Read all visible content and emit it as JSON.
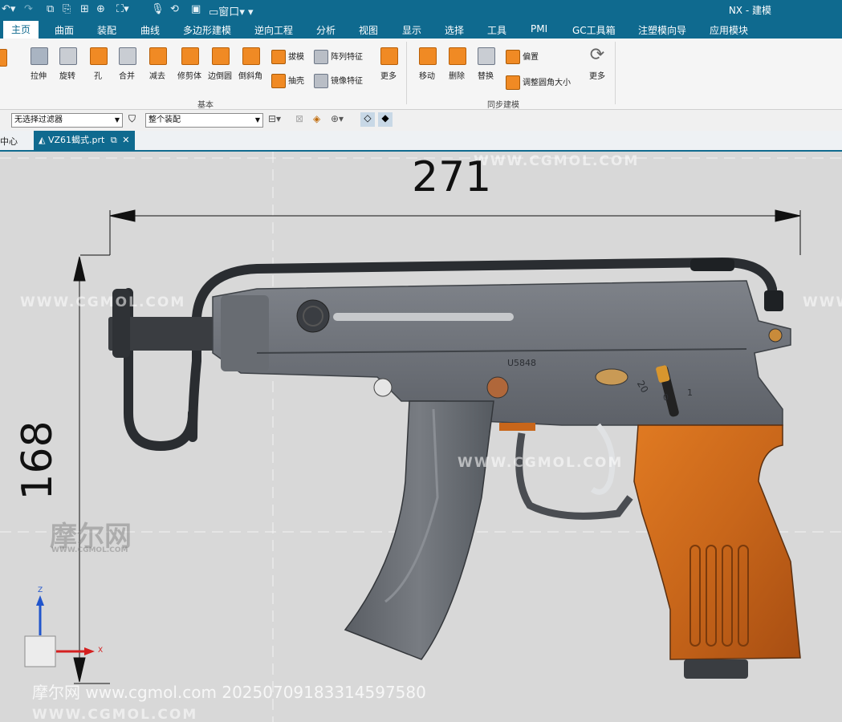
{
  "app": {
    "title": "NX - 建模"
  },
  "quick_access": {
    "window_label": "窗口"
  },
  "menu": {
    "tabs": [
      "主页",
      "曲面",
      "装配",
      "曲线",
      "多边形建模",
      "逆向工程",
      "分析",
      "视图",
      "显示",
      "选择",
      "工具",
      "PMI",
      "GC工具箱",
      "注塑模向导",
      "应用模块"
    ],
    "active": "主页"
  },
  "ribbon": {
    "basic_group": {
      "label": "基本",
      "buttons": [
        "拉伸",
        "旋转",
        "孔",
        "合并",
        "减去",
        "修剪体",
        "边倒圆",
        "倒斜角"
      ],
      "small_buttons": [
        "拔模",
        "阵列特征",
        "抽壳",
        "镜像特征"
      ],
      "more": "更多"
    },
    "sync_group": {
      "label": "同步建模",
      "buttons": [
        "移动",
        "删除",
        "替换"
      ],
      "small_buttons": [
        "偏置",
        "调整圆角大小"
      ],
      "more": "更多"
    }
  },
  "filter_bar": {
    "type_filter": "无选择过滤器",
    "scope_filter": "整个装配"
  },
  "doc_tabs": {
    "left_tab": "中心",
    "active_tab": "VZ61蝎式.prt"
  },
  "model": {
    "dim_width": "271",
    "dim_height": "168",
    "serial": "U5848",
    "selector_marks": [
      "20",
      "0",
      "1"
    ]
  },
  "csys": {
    "z": "Z",
    "x": "X"
  },
  "watermarks": {
    "site": "WWW.CGMOL.COM",
    "brand_cn": "摩尔网",
    "brand_sub": "WWW.CGMOL.COM",
    "footer": "摩尔网 www.cgmol.com 20250709183314597580"
  },
  "colors": {
    "brand_blue": "#0f6a8f",
    "wood": "#c8661a",
    "steel": "#6d7178",
    "accent_orange": "#f08a24"
  }
}
